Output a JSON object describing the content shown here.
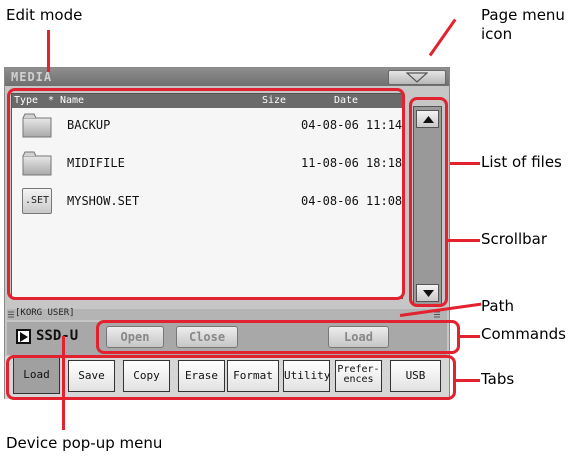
{
  "callouts": {
    "edit_mode": "Edit mode",
    "page_menu_icon_line1": "Page menu",
    "page_menu_icon_line2": "icon",
    "list_of_files": "List of files",
    "scrollbar": "Scrollbar",
    "path": "Path",
    "commands": "Commands",
    "tabs": "Tabs",
    "device_popup": "Device pop-up menu"
  },
  "screen": {
    "title": "MEDIA",
    "file_list": {
      "headers": {
        "type": "Type",
        "sort": "*",
        "name": "Name",
        "size": "Size",
        "date": "Date"
      },
      "rows": [
        {
          "icon": "folder-icon",
          "name": "BACKUP",
          "date": "04-08-06 11:14"
        },
        {
          "icon": "folder-icon",
          "name": "MIDIFILE",
          "date": "11-08-06 18:18"
        },
        {
          "icon": "set-file-icon",
          "icon_label": ".SET",
          "name": "MYSHOW.SET",
          "date": "04-08-06 11:08"
        }
      ]
    },
    "path": "[KORG USER]",
    "device": "SSD-U",
    "commands": {
      "open": "Open",
      "close": "Close",
      "load": "Load"
    },
    "tabs": [
      "Load",
      "Save",
      "Copy",
      "Erase",
      "Format",
      "Utility",
      "Prefer-",
      "USB"
    ],
    "tab_prefs_line2": "ences",
    "active_tab": "Load"
  },
  "colors": {
    "highlight": "#e2222e",
    "title_bar": "#6f6f6f",
    "screen_bg": "#c6c6c6"
  }
}
